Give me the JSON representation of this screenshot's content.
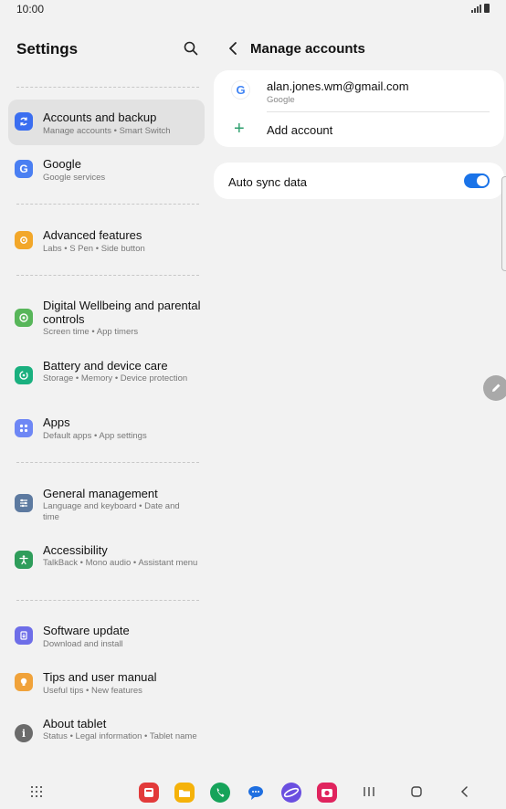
{
  "status": {
    "time": "10:00"
  },
  "settings": {
    "title": "Settings",
    "items": [
      {
        "label": "Accounts and backup",
        "sub": "Manage accounts  •  Smart Switch",
        "color": "#3b6ef0"
      },
      {
        "label": "Google",
        "sub": "Google services",
        "color": "#4a7ff2"
      },
      {
        "label": "Advanced features",
        "sub": "Labs  •  S Pen  •  Side button",
        "color": "#f2a72a"
      },
      {
        "label": "Digital Wellbeing and parental controls",
        "sub": "Screen time  •  App timers",
        "color": "#58b65a"
      },
      {
        "label": "Battery and device care",
        "sub": "Storage  •  Memory  •  Device protection",
        "color": "#1ab07f"
      },
      {
        "label": "Apps",
        "sub": "Default apps  •  App settings",
        "color": "#6e87f5"
      },
      {
        "label": "General management",
        "sub": "Language and keyboard  •  Date and time",
        "color": "#5d7aa0"
      },
      {
        "label": "Accessibility",
        "sub": "TalkBack  •  Mono audio  •  Assistant menu",
        "color": "#2f9d5b"
      },
      {
        "label": "Software update",
        "sub": "Download and install",
        "color": "#6e6ee8"
      },
      {
        "label": "Tips and user manual",
        "sub": "Useful tips  •  New features",
        "color": "#f0a23a"
      },
      {
        "label": "About tablet",
        "sub": "Status  •  Legal information  •  Tablet name",
        "color": "#6b6b6b"
      }
    ]
  },
  "manage": {
    "title": "Manage accounts",
    "account_email": "alan.jones.wm@gmail.com",
    "account_type": "Google",
    "add_account": "Add account",
    "auto_sync": "Auto sync data",
    "auto_sync_on": true
  },
  "icons": {
    "search": "search-icon",
    "back": "back-arrow-icon",
    "edit": "pencil-icon"
  },
  "dock": [
    {
      "name": "red-notes-app",
      "color": "#e23a3a"
    },
    {
      "name": "my-files-app",
      "color": "#f5b20a"
    },
    {
      "name": "phone-app",
      "color": "#16a35a"
    },
    {
      "name": "messages-app",
      "color": "#1f6fe0"
    },
    {
      "name": "internet-app",
      "color": "#6a4fe0"
    },
    {
      "name": "camera-app",
      "color": "#e0245e"
    }
  ]
}
